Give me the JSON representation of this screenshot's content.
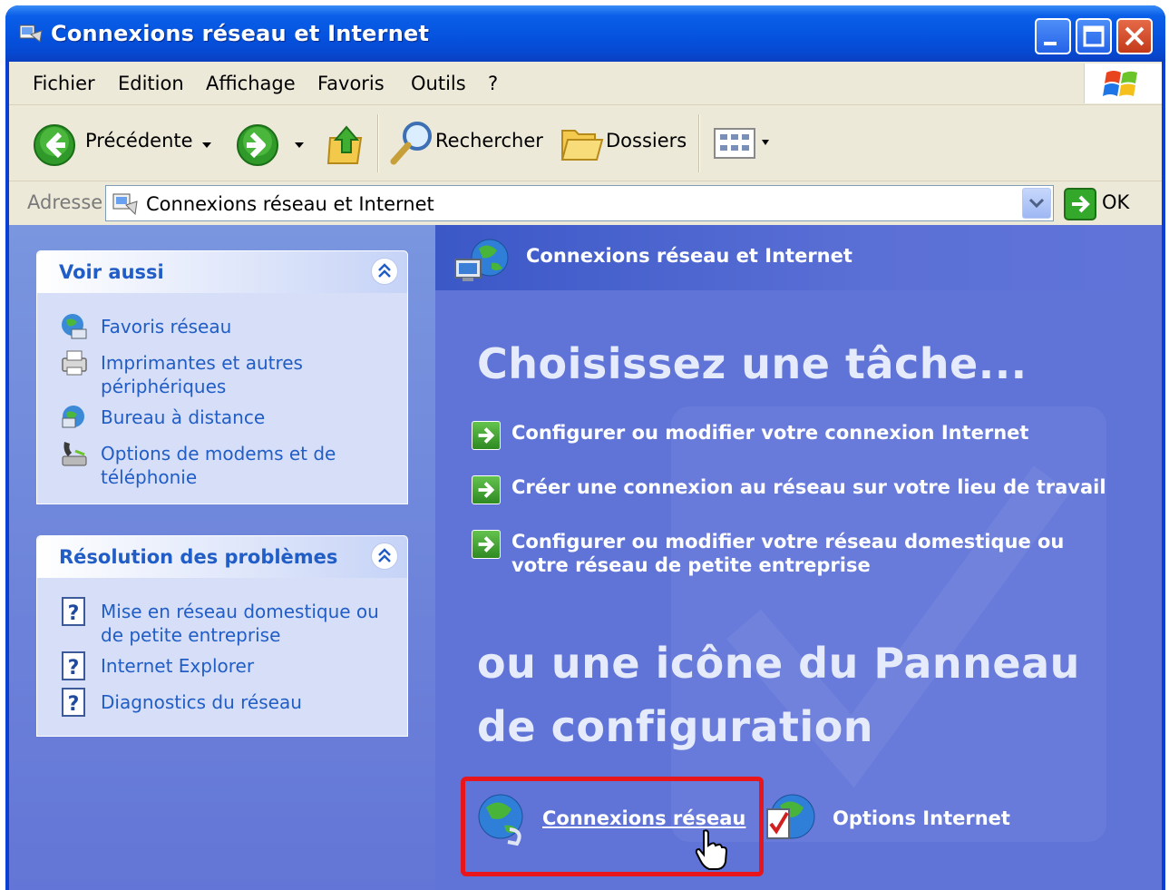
{
  "window": {
    "title": "Connexions réseau et Internet"
  },
  "menu": {
    "items": [
      "Fichier",
      "Edition",
      "Affichage",
      "Favoris",
      "Outils",
      "?"
    ]
  },
  "toolbar": {
    "back_label": "Précédente",
    "search_label": "Rechercher",
    "folders_label": "Dossiers"
  },
  "address": {
    "label": "Adresse",
    "value": "Connexions réseau et Internet",
    "go_label": "OK"
  },
  "sidebar": {
    "see_also": {
      "title": "Voir aussi",
      "items": [
        {
          "label": "Favoris réseau",
          "icon": "network-places-icon"
        },
        {
          "label": "Imprimantes et autres périphériques",
          "icon": "printer-icon"
        },
        {
          "label": "Bureau à distance",
          "icon": "remote-desktop-icon"
        },
        {
          "label": "Options de modems et de téléphonie",
          "icon": "phone-modem-icon"
        }
      ]
    },
    "troubleshoot": {
      "title": "Résolution des problèmes",
      "items": [
        {
          "label": "Mise en réseau domestique ou de petite entreprise",
          "icon": "help-icon"
        },
        {
          "label": "Internet Explorer",
          "icon": "help-icon"
        },
        {
          "label": "Diagnostics du réseau",
          "icon": "help-icon"
        }
      ]
    }
  },
  "main": {
    "section_title": "Connexions réseau et Internet",
    "heading_tasks": "Choisissez une tâche...",
    "tasks": [
      "Configurer ou modifier votre connexion Internet",
      "Créer une connexion au réseau sur votre lieu de travail",
      "Configurer ou modifier votre réseau domestique ou votre réseau de petite entreprise"
    ],
    "heading_icons": "ou une icône du Panneau de configuration",
    "icons": [
      {
        "label": "Connexions réseau",
        "icon": "network-connections-icon",
        "highlighted": true
      },
      {
        "label": "Options Internet",
        "icon": "internet-options-icon",
        "highlighted": false
      }
    ]
  },
  "colors": {
    "title_bar": "#0553df",
    "left_pane": "#6f86db",
    "right_pane": "#6074d8",
    "link_blue": "#215dc6",
    "highlight_red": "#e8161b"
  }
}
